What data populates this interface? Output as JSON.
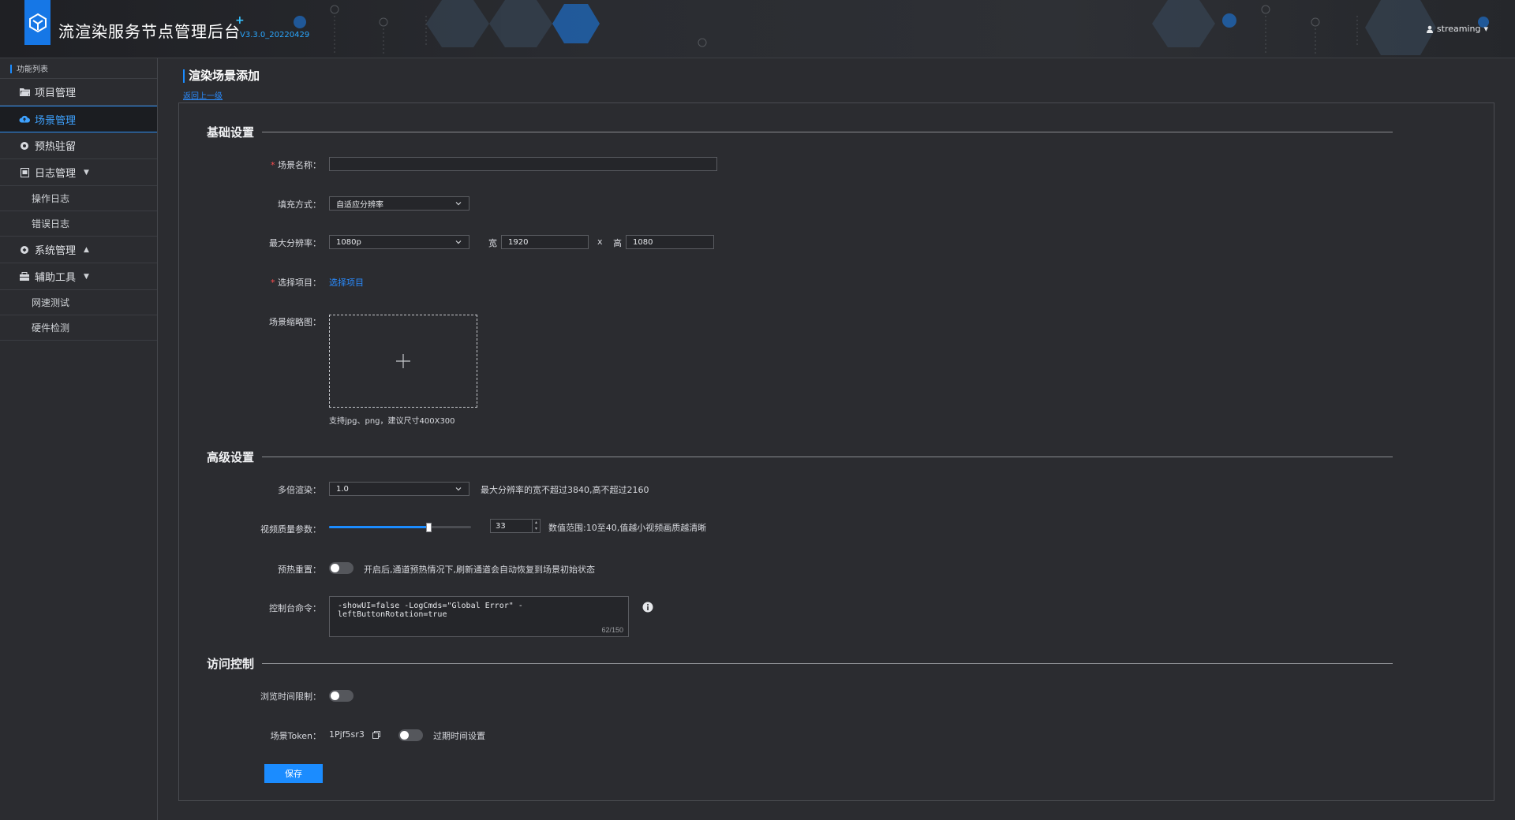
{
  "header": {
    "app_title": "流渲染服务节点管理后台",
    "plus_mark": "+",
    "version": "V3.3.0_20220429",
    "username": "streaming",
    "user_caret": "▾"
  },
  "sidebar": {
    "heading": "功能列表",
    "items": [
      {
        "label": "项目管理",
        "icon": "folder-icon"
      },
      {
        "label": "场景管理",
        "icon": "cloud-icon",
        "active": true
      },
      {
        "label": "预热驻留",
        "icon": "gear-icon"
      },
      {
        "label": "日志管理",
        "icon": "log-icon",
        "caret": "▼"
      },
      {
        "label": "系统管理",
        "icon": "settings-icon",
        "caret": "▲"
      },
      {
        "label": "辅助工具",
        "icon": "toolbox-icon",
        "caret": "▼"
      }
    ],
    "log_sub": [
      "操作日志",
      "错误日志"
    ],
    "tool_sub": [
      "网速测试",
      "硬件检测"
    ]
  },
  "page": {
    "title": "渲染场景添加",
    "back_link": "返回上一级"
  },
  "sections": {
    "basic": "基础设置",
    "advanced": "高级设置",
    "access": "访问控制"
  },
  "form": {
    "scene_name_label": "场景名称：",
    "scene_name_value": "",
    "fill_mode_label": "填充方式：",
    "fill_mode_value": "自适应分辨率",
    "max_res_label": "最大分辨率：",
    "max_res_value": "1080p",
    "width_label": "宽",
    "width_value": "1920",
    "x_sep": "x",
    "height_label": "高",
    "height_value": "1080",
    "project_label": "选择项目：",
    "project_link": "选择项目",
    "thumb_label": "场景缩略图：",
    "thumb_hint": "支持jpg、png，建议尺寸400X300",
    "multi_render_label": "多倍渲染：",
    "multi_render_value": "1.0",
    "multi_render_hint": "最大分辨率的宽不超过3840,高不超过2160",
    "quality_label": "视频质量参数：",
    "quality_value": "33",
    "quality_fraction": 0.7,
    "quality_hint": "数值范围:10至40,值越小视频画质越清晰",
    "preheat_reset_label": "预热重置：",
    "preheat_reset_hint": "开启后,通道预热情况下,刷新通道会自动恢复到场景初始状态",
    "console_label": "控制台命令：",
    "console_value": "-showUI=false -LogCmds=\"Global Error\" -leftButtonRotation=true",
    "console_counter": "62/150",
    "browse_limit_label": "浏览时间限制：",
    "token_label": "场景Token：",
    "token_value": "1Pjf5sr3",
    "expire_label": "过期时间设置",
    "save_label": "保存"
  },
  "colors": {
    "accent": "#1b8cff",
    "background": "#2b2c30",
    "required": "#ff4d4f"
  }
}
